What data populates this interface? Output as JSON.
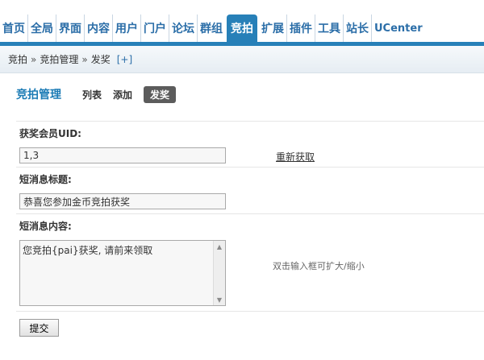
{
  "nav": {
    "items": [
      {
        "label": "首页"
      },
      {
        "label": "全局"
      },
      {
        "label": "界面"
      },
      {
        "label": "内容"
      },
      {
        "label": "用户"
      },
      {
        "label": "门户"
      },
      {
        "label": "论坛"
      },
      {
        "label": "群组"
      },
      {
        "label": "竞拍",
        "active": true
      },
      {
        "label": "扩展"
      },
      {
        "label": "插件"
      },
      {
        "label": "工具"
      },
      {
        "label": "站长"
      },
      {
        "label": "UCenter"
      }
    ]
  },
  "breadcrumb": {
    "items": [
      "竞拍",
      "竞拍管理",
      "发奖"
    ],
    "separator": "»",
    "add": "[+]"
  },
  "section": {
    "title": "竞拍管理",
    "tabs": [
      {
        "label": "列表"
      },
      {
        "label": "添加"
      },
      {
        "label": "发奖",
        "active": true
      }
    ]
  },
  "form": {
    "uid_label": "获奖会员UID:",
    "uid_value": "1,3",
    "refresh_link": "重新获取",
    "subject_label": "短消息标题:",
    "subject_value": "恭喜您参加金币竞拍获奖",
    "content_label": "短消息内容:",
    "content_value": "您竞拍{pai}获奖, 请前来领取",
    "hint": "双击输入框可扩大/缩小",
    "submit_label": "提交"
  },
  "colors": {
    "accent": "#2780b8",
    "nav_text": "#2b6ea8",
    "title": "#1b7bb5"
  }
}
